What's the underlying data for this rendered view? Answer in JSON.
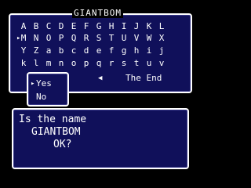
{
  "name_entry": {
    "title": "GIANTBOM",
    "rows": [
      [
        "A",
        "B",
        "C",
        "D",
        "E",
        "F",
        "G",
        "H",
        "I",
        "J",
        "K",
        "L"
      ],
      [
        "M",
        "N",
        "O",
        "P",
        "Q",
        "R",
        "S",
        "T",
        "U",
        "V",
        "W",
        "X"
      ],
      [
        "Y",
        "Z",
        "a",
        "b",
        "c",
        "d",
        "e",
        "f",
        "g",
        "h",
        "i",
        "j"
      ],
      [
        "k",
        "l",
        "m",
        "n",
        "o",
        "p",
        "q",
        "r",
        "s",
        "t",
        "u",
        "v"
      ]
    ],
    "row2_cursor": "▸",
    "back_arrow": "◀",
    "end_label": "The End"
  },
  "confirm": {
    "cursor": "▸",
    "yes_label": "Yes",
    "no_label": "No"
  },
  "message": {
    "line1": "Is the name",
    "line2": "GIANTBOM",
    "line3": "OK?"
  },
  "colors": {
    "panel_bg": "#10105a",
    "border": "#ffffff",
    "text": "#ffffff"
  }
}
